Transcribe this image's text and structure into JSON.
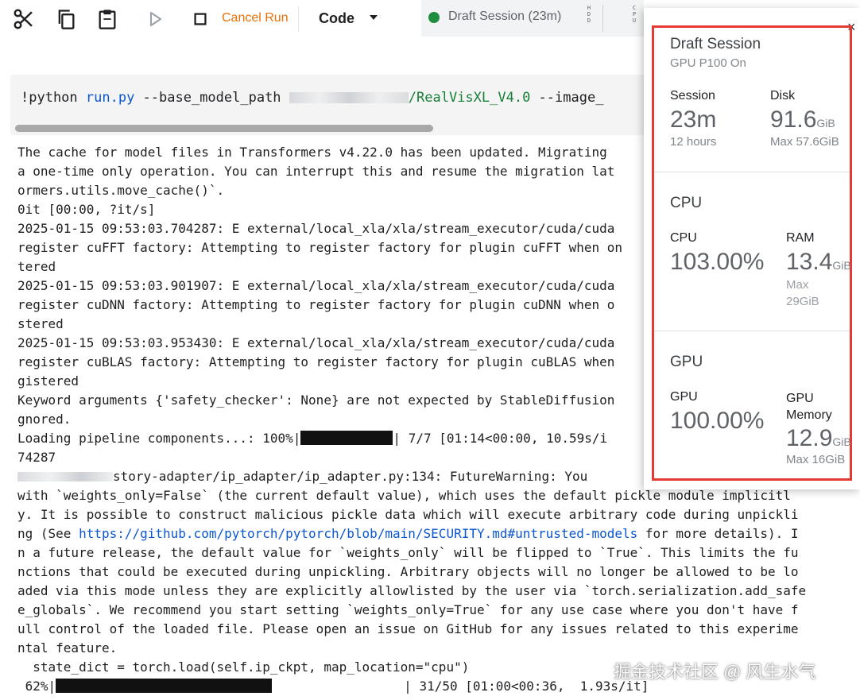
{
  "toolbar": {
    "cancel_run_label": "Cancel Run",
    "code_label": "Code",
    "session_status": "Draft Session (23m)",
    "hdd_label": [
      "H",
      "D",
      "D"
    ],
    "cpu_label": [
      "C",
      "P",
      "U"
    ],
    "icons": [
      "scissors-icon",
      "copy-icon",
      "clipboard-icon",
      "play-icon",
      "stop-icon"
    ]
  },
  "code_cell": {
    "prefix": "!python ",
    "file": "run.py",
    "args_before": " --base_model_path ",
    "path_tail": "/RealVisXL_V4.0",
    "args_after": " --image_"
  },
  "output": {
    "lines": [
      "The cache for model files in Transformers v4.22.0 has been updated. Migrating",
      "a one-time only operation. You can interrupt this and resume the migration lat",
      "ormers.utils.move_cache()`.",
      "0it [00:00, ?it/s]",
      "2025-01-15 09:53:03.704287: E external/local_xla/xla/stream_executor/cuda/cuda",
      "register cuFFT factory: Attempting to register factory for plugin cuFFT when on",
      "tered",
      "2025-01-15 09:53:03.901907: E external/local_xla/xla/stream_executor/cuda/cuda",
      "register cuDNN factory: Attempting to register factory for plugin cuDNN when o",
      "stered",
      "2025-01-15 09:53:03.953430: E external/local_xla/xla/stream_executor/cuda/cuda",
      "register cuBLAS factory: Attempting to register factory for plugin cuBLAS when",
      "gistered",
      "Keyword arguments {'safety_checker': None} are not expected by StableDiffusion",
      "gnored."
    ],
    "loading_prefix": "Loading pipeline components...: 100%|",
    "loading_suffix": "| 7/7 [01:14<00:00, 10.59s/i",
    "line_74287": "74287",
    "warning_tail": "story-adapter/ip_adapter/ip_adapter.py:134: FutureWarning: You",
    "lines2a": [
      "with `weights_only=False` (the current default value), which uses the default pickle module implicitl",
      "y. It is possible to construct malicious pickle data which will execute arbitrary code during unpickli"
    ],
    "see_prefix": "ng (See ",
    "security_link": "https://github.com/pytorch/pytorch/blob/main/SECURITY.md#untrusted-models",
    "see_suffix": " for more details). I",
    "lines2b": [
      "n a future release, the default value for `weights_only` will be flipped to `True`. This limits the fu",
      "nctions that could be executed during unpickling. Arbitrary objects will no longer be allowed to be lo",
      "aded via this mode unless they are explicitly allowlisted by the user via `torch.serialization.add_safe",
      "e_globals`. We recommend you start setting `weights_only=True` for any use case where you don't have f",
      "ull control of the loaded file. Please open an issue on GitHub for any issues related to this experime",
      "ntal feature.",
      "  state_dict = torch.load(self.ip_ckpt, map_location=\"cpu\")"
    ],
    "progress_prefix": " 62%|",
    "progress_fraction": 0.62,
    "progress_suffix": "| 31/50 [01:00<00:36,  1.93s/it]"
  },
  "popup": {
    "title": "Draft Session",
    "subtitle": "GPU P100 On",
    "session_label": "Session",
    "session_value": "23m",
    "session_limit": "12 hours",
    "disk_label": "Disk",
    "disk_value": "91.6",
    "disk_unit": "GiB",
    "disk_max": "Max 57.6GiB",
    "cpu_section": "CPU",
    "cpu_label": "CPU",
    "cpu_value": "103.00%",
    "ram_label": "RAM",
    "ram_value": "13.4",
    "ram_unit": "GiB",
    "ram_max": "Max\n29GiB",
    "gpu_section": "GPU",
    "gpu_label": "GPU",
    "gpu_value": "100.00%",
    "gpu_mem_label": "GPU\nMemory",
    "gpu_mem_value": "12.9",
    "gpu_mem_unit": "GiB",
    "gpu_mem_max": "Max 16GiB",
    "close_glyph": "×"
  },
  "watermark": "掘金技术社区 @ 风生水气",
  "colors": {
    "accent_orange": "#e8710a",
    "status_green": "#1e8e3e",
    "highlight_red": "#e53935",
    "link_blue": "#0b57d0"
  }
}
